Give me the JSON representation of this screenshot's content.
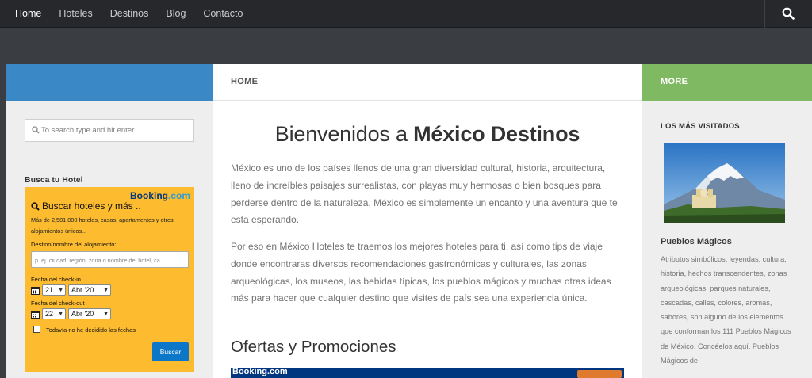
{
  "nav": {
    "items": [
      "Home",
      "Hoteles",
      "Destinos",
      "Blog",
      "Contacto"
    ],
    "active": "Home"
  },
  "headers": {
    "middle": "HOME",
    "right": "MORE"
  },
  "left_sidebar": {
    "search_placeholder": "To search type and hit enter",
    "widget_title": "Busca tu Hotel",
    "booking": {
      "logo_main": "Booking",
      "logo_suffix": ".com",
      "title": "Buscar hoteles y más ..",
      "description": "Más de 2,581,000 hoteles, casas, apartamentos y otros alojamientos únicos...",
      "destination_label": "Destino/nombre del alojamiento:",
      "destination_placeholder": "p. ej. ciudad, región, zona o nombre del hotel, ca...",
      "checkin_label": "Fecha del check-in",
      "checkin_day": "21",
      "checkin_month": "Abr '20",
      "checkout_label": "Fecha del check-out",
      "checkout_day": "22",
      "checkout_month": "Abr '20",
      "no_dates_label": "Todavía no he decidido las fechas",
      "submit_label": "Buscar"
    }
  },
  "main": {
    "title_prefix": "Bienvenidos a ",
    "title_bold": "México Destinos",
    "paragraph1": "México es uno de los países llenos de una gran diversidad cultural, historia, arquitectura, lleno de increíbles paisajes surrealistas, con playas muy hermosas o bien bosques para perderse dentro de la naturaleza, México es simplemente un encanto y una aventura que te esta esperando.",
    "paragraph2": "Por eso en México Hoteles te traemos los mejores hoteles para ti, así como tips de viaje donde encontraras diversos recomendaciones gastronómicas y culturales, las zonas arqueológicas, los museos, las bebidas típicas, los pueblos mágicos y muchas otras ideas más para hacer que cualquier destino que visites de país sea una experiencia única.",
    "section_title": "Ofertas y Promociones",
    "banner_text": "Booking.com"
  },
  "right_sidebar": {
    "title": "LOS MÁS VISITADOS",
    "card_title": "Pueblos Mágicos",
    "card_text": "Atributos simbólicos, leyendas, cultura, historia, hechos transcendentes, zonas arqueológicas, parques naturales, cascadas, calles, colores, aromas, sabores, son alguno de los elementos que conforman los 111 Pueblos Mágicos de México. Concéelos aquí. Pueblos Mágicos de"
  },
  "colors": {
    "topbar": "#26282b",
    "blue_header": "#3a88c5",
    "green_header": "#7fba62",
    "booking_yellow": "#fdbb30",
    "booking_blue": "#003580",
    "button_blue": "#0c77c9"
  }
}
